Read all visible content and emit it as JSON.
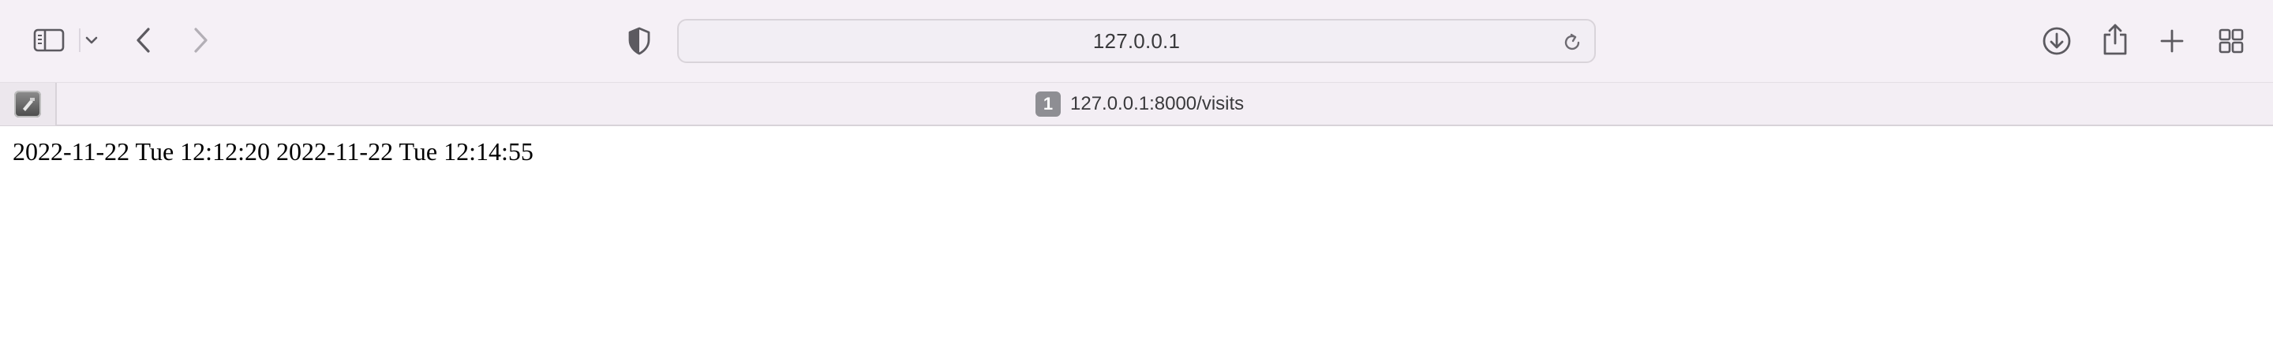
{
  "toolbar": {
    "address": "127.0.0.1",
    "icons": {
      "sidebar": "sidebar-icon",
      "sidebar_menu": "chevron-down-icon",
      "back": "chevron-left-icon",
      "forward": "chevron-right-icon",
      "privacy": "shield-icon",
      "reload": "reload-icon",
      "downloads": "download-icon",
      "share": "share-icon",
      "new_tab": "plus-icon",
      "tab_overview": "grid-icon"
    }
  },
  "tabs": {
    "pinned": {
      "icon": "pinned-tab-favicon"
    },
    "active": {
      "badge": "1",
      "title": "127.0.0.1:8000/visits"
    }
  },
  "page": {
    "text": "2022-11-22 Tue 12:12:20 2022-11-22 Tue 12:14:55"
  },
  "colors": {
    "chrome_bg": "#f5f0f6",
    "text": "#3a3a3c",
    "icon": "#5c5a60",
    "icon_disabled": "#b3afb6"
  }
}
